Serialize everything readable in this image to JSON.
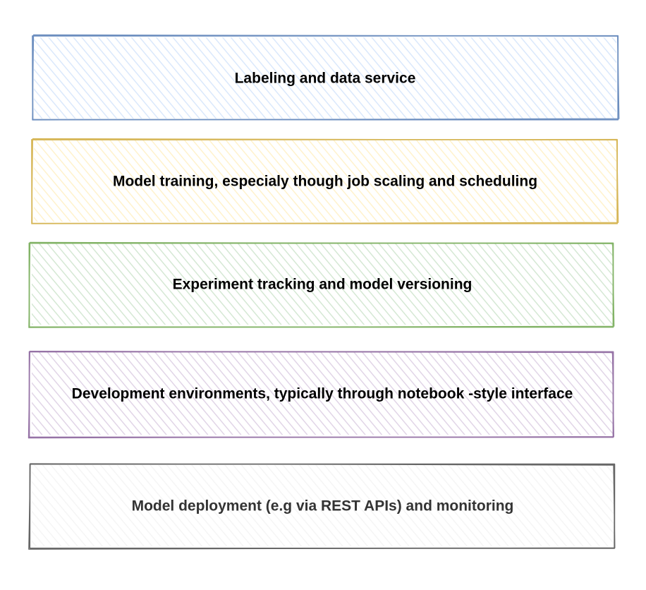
{
  "diagram": {
    "boxes": [
      {
        "label": "Labeling and data service",
        "stroke": "#6c8ebf",
        "fill": "#dae8fc",
        "text_color": "#000000"
      },
      {
        "label": "Model training, especialy though job scaling and scheduling",
        "stroke": "#d6b656",
        "fill": "#fff2cc",
        "text_color": "#000000"
      },
      {
        "label": "Experiment tracking and model versioning",
        "stroke": "#82b366",
        "fill": "#d5e8d4",
        "text_color": "#000000"
      },
      {
        "label": "Development environments, typically through notebook -style interface",
        "stroke": "#9673a6",
        "fill": "#e1d5e7",
        "text_color": "#000000"
      },
      {
        "label": "Model deployment (e.g via REST APIs) and monitoring",
        "stroke": "#666666",
        "fill": "#f5f5f5",
        "text_color": "#333333"
      }
    ]
  }
}
